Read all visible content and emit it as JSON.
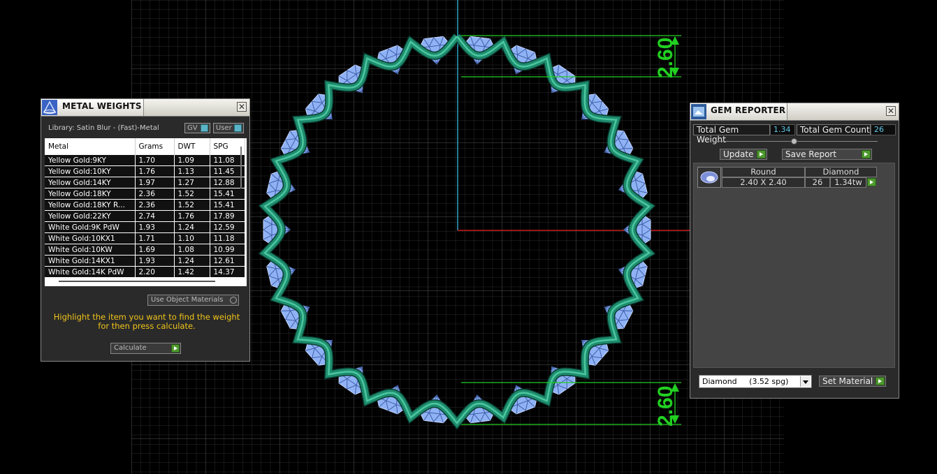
{
  "metal_weights": {
    "title": "METAL WEIGHTS",
    "close": "✕",
    "library": "Library: Satin Blur - (Fast)-Metal",
    "gv_label": "GV",
    "user_label": "User",
    "columns": [
      "Metal",
      "Grams",
      "DWT",
      "SPG"
    ],
    "rows": [
      [
        "Yellow Gold:9KY",
        "1.70",
        "1.09",
        "11.08"
      ],
      [
        "Yellow Gold:10KY",
        "1.76",
        "1.13",
        "11.45"
      ],
      [
        "Yellow Gold:14KY",
        "1.97",
        "1.27",
        "12.88"
      ],
      [
        "Yellow Gold:18KY",
        "2.36",
        "1.52",
        "15.41"
      ],
      [
        "Yellow Gold:18KY R...",
        "2.36",
        "1.52",
        "15.41"
      ],
      [
        "Yellow Gold:22KY",
        "2.74",
        "1.76",
        "17.89"
      ],
      [
        "White Gold:9K PdW",
        "1.93",
        "1.24",
        "12.59"
      ],
      [
        "White Gold:10KX1",
        "1.71",
        "1.10",
        "11.18"
      ],
      [
        "White Gold:10KW",
        "1.69",
        "1.08",
        "10.99"
      ],
      [
        "White Gold:14KX1",
        "1.93",
        "1.24",
        "12.61"
      ],
      [
        "White Gold:14K PdW",
        "2.20",
        "1.42",
        "14.37"
      ]
    ],
    "use_object_materials": "Use Object Materials",
    "instruction": "Highlight the item you want to find the weight for then press calculate.",
    "calculate": "Calculate"
  },
  "gem_reporter": {
    "title": "GEM REPORTER",
    "close": "✕",
    "total_weight_label": "Total Gem Weight",
    "total_weight_value": "1.34",
    "total_count_label": "Total Gem Count",
    "total_count_value": "26",
    "update": "Update",
    "save_report": "Save Report",
    "columns": [
      "Round",
      "Diamond"
    ],
    "row": {
      "size": "2.40 X 2.40",
      "count": "26",
      "weight": "1.34tw"
    },
    "material_select": "Diamond     (3.52 spg)",
    "set_material": "Set Material"
  },
  "dimensions": {
    "top": "2.60",
    "bottom": "2.60"
  },
  "colors": {
    "grid": "#2e2e2e",
    "grid_major": "#4a4a4a",
    "metal": "#1e8c6e",
    "gem": "#8fb2f5",
    "dim": "#2ad42a",
    "axis_y": "#3aa8c8",
    "axis_x": "#c82020"
  }
}
